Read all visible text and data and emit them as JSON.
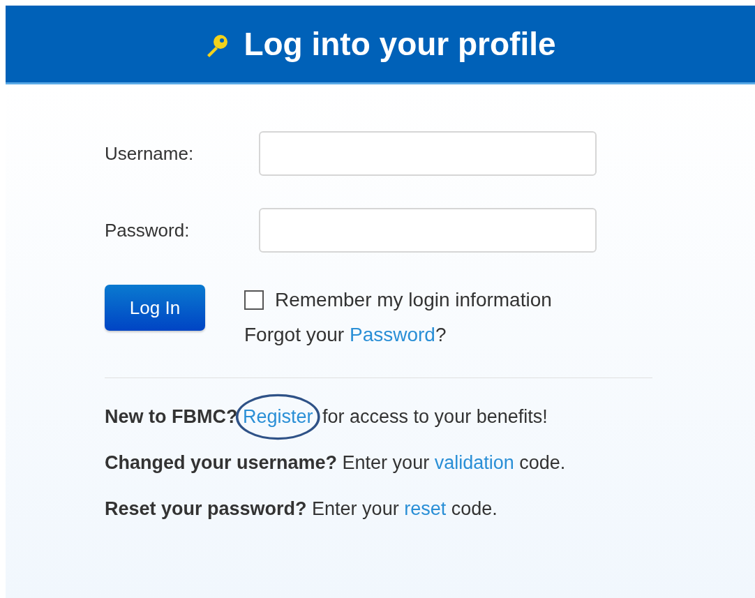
{
  "header": {
    "title": "Log into your profile"
  },
  "fields": [
    {
      "label": "Username:"
    },
    {
      "label": "Password:"
    }
  ],
  "login_button": "Log In",
  "remember": {
    "label": "Remember my login information",
    "checked": false
  },
  "forgot": {
    "before": "Forgot your ",
    "link": "Password",
    "after": "?"
  },
  "help_lines": [
    {
      "lead": "New to FBMC?",
      "link": "Register",
      "after": " for access to your benefits!",
      "circled": true
    },
    {
      "lead": "Changed your username?",
      "before": " Enter your ",
      "link": "validation",
      "after": " code.",
      "circled": false
    },
    {
      "lead": "Reset your password?",
      "before": " Enter your ",
      "link": "reset",
      "after": " code.",
      "circled": false
    }
  ]
}
